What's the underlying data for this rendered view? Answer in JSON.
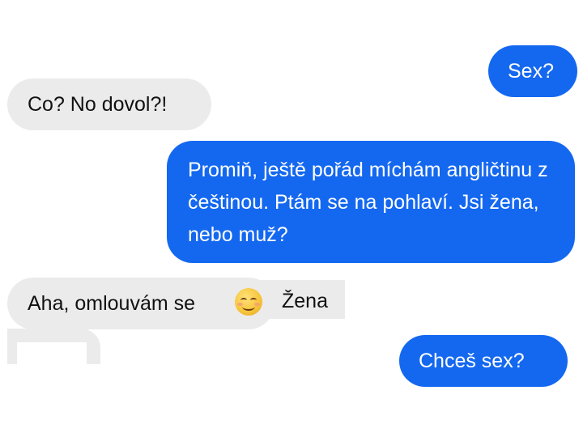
{
  "messages": [
    {
      "side": "outgoing",
      "text": "Sex?"
    },
    {
      "side": "incoming",
      "text": "Co? No dovol?!"
    },
    {
      "side": "outgoing",
      "text": "Promiň, ještě pořád míchám angličtinu z češtinou. Ptám se na pohlaví. Jsi žena, nebo muž?"
    },
    {
      "side": "incoming",
      "text": "Aha, omlouvám se",
      "emoji": "smiling-face-with-smiling-eyes",
      "text_after": "Žena"
    },
    {
      "side": "outgoing",
      "text": "Chceš sex?"
    }
  ],
  "colors": {
    "outgoing_bubble": "#1468f0",
    "incoming_bubble": "#ebebeb",
    "outgoing_text": "#ffffff",
    "incoming_text": "#111111"
  }
}
